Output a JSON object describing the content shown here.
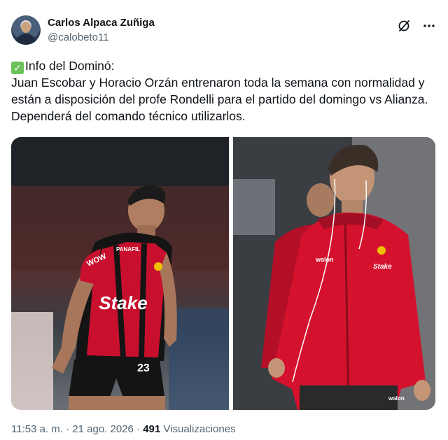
{
  "author": {
    "name": "Carlos Alpaca Zuñiga",
    "handle": "@calobeto11"
  },
  "tweet": {
    "text": "Info del Dominó:\nJuan Escobar y Horacio Orzán entrenaron toda la semana con normalidad y están a disposición del profe Rondelli para el partido del domingo vs Alianza. Dependerá del comando técnico utilizarlos."
  },
  "icons": {
    "grok": "slash-circle-icon",
    "more": "more-icon",
    "check": "check-mark-emoji"
  },
  "photos": {
    "left": {
      "shirt_sponsor_chest": "Stake",
      "shirt_top_left": "PANAFIL",
      "shirt_sleeve": "WOW",
      "shirt_number": "23"
    },
    "right": {
      "jacket_brand": "walon",
      "jacket_sponsor": "Stake",
      "pants_brand": "walon"
    }
  },
  "meta": {
    "time": "11:53 a. m.",
    "date": "21 ago. 2026",
    "separator": "·",
    "views_count": "491",
    "views_label": "Visualizaciones"
  },
  "colors": {
    "text": "#0f1419",
    "muted": "#536471",
    "kit_red": "#c8102e",
    "kit_black": "#141414"
  }
}
